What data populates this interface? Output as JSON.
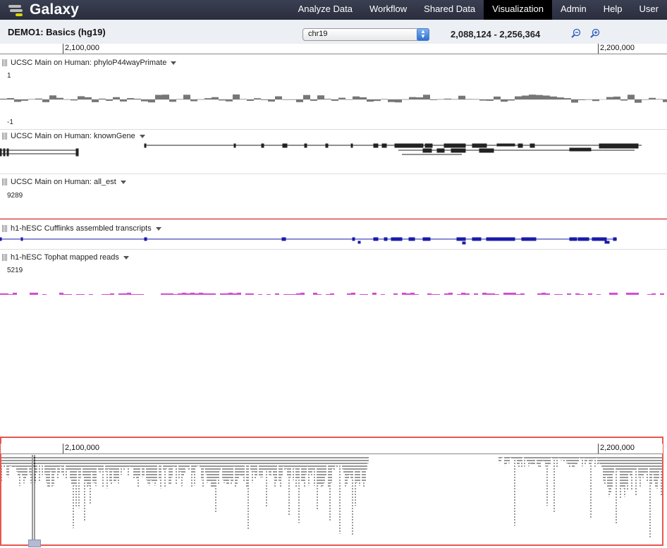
{
  "app": {
    "name": "Galaxy"
  },
  "nav": {
    "items": [
      {
        "label": "Analyze Data",
        "active": false
      },
      {
        "label": "Workflow",
        "active": false
      },
      {
        "label": "Shared Data",
        "active": false
      },
      {
        "label": "Visualization",
        "active": true
      },
      {
        "label": "Admin",
        "active": false
      },
      {
        "label": "Help",
        "active": false
      },
      {
        "label": "User",
        "active": false
      }
    ]
  },
  "toolbar": {
    "title": "DEMO1: Basics (hg19)",
    "chromosome": "chr19",
    "location": "2,088,124 - 2,256,364",
    "zoom_out_icon": "zoom-out-icon",
    "zoom_in_icon": "zoom-in-icon"
  },
  "ruler": {
    "tick_labels": [
      "2,100,000",
      "2,200,000"
    ]
  },
  "tracks": [
    {
      "name": "UCSC Main on Human: phyloP44wayPrimate",
      "max": "1",
      "min": "-1",
      "color": "#777777"
    },
    {
      "name": "UCSC Main on Human: knownGene",
      "color": "#222222"
    },
    {
      "name": "UCSC Main on Human: all_est",
      "max": "9289",
      "color": "#cc0000"
    },
    {
      "name": "h1-hESC Cufflinks assembled transcripts",
      "color": "#1a1aaa"
    },
    {
      "name": "h1-hESC Tophat mapped reads",
      "max": "5219",
      "color": "#d24dd2"
    }
  ],
  "overview": {
    "tick_labels": [
      "2,100,000",
      "2,200,000"
    ],
    "highlight_color": "#e8564e"
  },
  "colors": {
    "topbar": "#2c3143",
    "active_nav": "#000000",
    "accent_select": "#2d6fd1"
  }
}
